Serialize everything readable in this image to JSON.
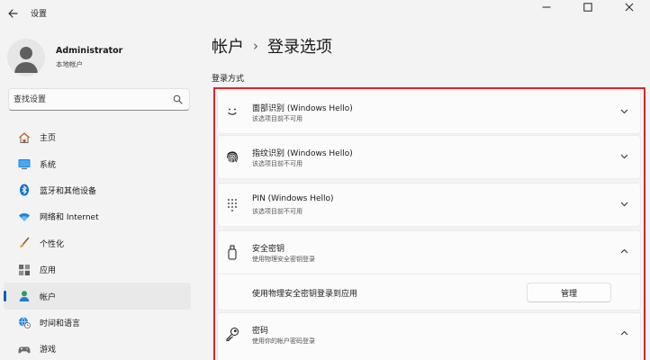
{
  "window": {
    "title": "设置",
    "controls": [
      "minimize",
      "maximize",
      "close"
    ]
  },
  "profile": {
    "name": "Administrator",
    "account_type": "本地帐户"
  },
  "search": {
    "placeholder": "查找设置"
  },
  "sidebar": {
    "items": [
      {
        "label": "主页",
        "icon": "home-icon"
      },
      {
        "label": "系统",
        "icon": "system-icon"
      },
      {
        "label": "蓝牙和其他设备",
        "icon": "bluetooth-icon"
      },
      {
        "label": "网络和 Internet",
        "icon": "wifi-icon"
      },
      {
        "label": "个性化",
        "icon": "brush-icon"
      },
      {
        "label": "应用",
        "icon": "apps-icon"
      },
      {
        "label": "帐户",
        "icon": "account-icon",
        "active": true
      },
      {
        "label": "时间和语言",
        "icon": "globe-clock-icon"
      },
      {
        "label": "游戏",
        "icon": "gamepad-icon"
      }
    ]
  },
  "breadcrumb": {
    "parent": "帐户",
    "separator": "›",
    "current": "登录选项"
  },
  "section": {
    "title": "登录方式"
  },
  "sign_in_options": [
    {
      "title": "面部识别 (Windows Hello)",
      "subtitle": "该选项目前不可用",
      "icon": "face-icon",
      "expanded": false
    },
    {
      "title": "指纹识别 (Windows Hello)",
      "subtitle": "该选项目前不可用",
      "icon": "fingerprint-icon",
      "expanded": false
    },
    {
      "title": "PIN (Windows Hello)",
      "subtitle": "该选项目前不可用",
      "icon": "pin-keypad-icon",
      "expanded": false
    },
    {
      "title": "安全密钥",
      "subtitle": "使用物理安全密钥登录",
      "icon": "security-key-icon",
      "expanded": true,
      "detail": {
        "label": "使用物理安全密钥登录到应用",
        "button": "管理"
      }
    },
    {
      "title": "密码",
      "subtitle": "使用你的帐户密码登录",
      "icon": "key-icon",
      "expanded": true
    }
  ],
  "colors": {
    "accent": "#005fb8",
    "highlight_border": "#d9262c",
    "background": "#f3f3f3",
    "card": "#fbfbfb"
  }
}
